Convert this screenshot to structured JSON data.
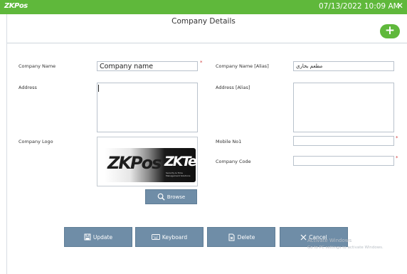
{
  "titlebar": {
    "logo": "ZKPos",
    "datetime": "07/13/2022 10:09 AM",
    "close_glyph": "✕",
    "color": "#5fb83b"
  },
  "header": {
    "title": "Company Details",
    "add_glyph": "+"
  },
  "form": {
    "company_name_label": "Company Name",
    "company_name_value": "Company name",
    "company_name_alias_label": "Company Name [Alias]",
    "company_name_alias_value": "مطعم بخاري",
    "address_label": "Address",
    "address_alias_label": "Address [Alias]",
    "company_logo_label": "Company Logo",
    "mobile_label": "Mobile No1",
    "company_code_label": "Company Code",
    "required_mark": "*"
  },
  "logo_image": {
    "left_text": "ZKPos",
    "right_text": "ZKTeco",
    "tagline": "Security & Time Management Solutions"
  },
  "buttons": {
    "browse": "Browse",
    "update": "Update",
    "keyboard": "Keyboard",
    "delete": "Delete",
    "cancel": "Cancel"
  },
  "watermark": {
    "line1": "Activate Windows",
    "line2": "Go to PC settings to activate Windows."
  },
  "colors": {
    "accent": "#5fb83b",
    "button": "#6f8da7",
    "required": "#d04040"
  },
  "icons": {
    "close": "close-icon",
    "add": "plus-icon",
    "browse": "search-icon",
    "update": "save-icon",
    "keyboard": "keyboard-icon",
    "delete": "delete-icon",
    "cancel": "close-icon"
  }
}
